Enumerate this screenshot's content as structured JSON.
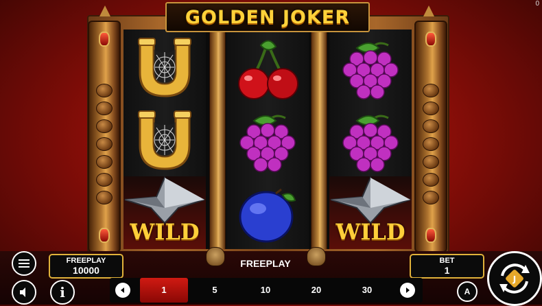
{
  "game": {
    "title": "GOLDEN JOKER",
    "corner_counter": "0"
  },
  "reels": [
    {
      "symbols": [
        "horseshoe",
        "horseshoe",
        "wild"
      ]
    },
    {
      "symbols": [
        "cherry",
        "grapes",
        "plum"
      ]
    },
    {
      "symbols": [
        "grapes",
        "grapes",
        "wild"
      ]
    }
  ],
  "symbols": {
    "wild_label": "WILD"
  },
  "freeplay_box": {
    "label": "FREEPLAY",
    "value": "10000"
  },
  "status_text": "FREEPLAY",
  "bet_box": {
    "label": "BET",
    "value": "1"
  },
  "bet_options": [
    "1",
    "5",
    "10",
    "20",
    "30"
  ],
  "selected_bet": "1",
  "controls": {
    "auto_label": "A",
    "info_label": "i"
  },
  "icons": {
    "menu": "menu-icon",
    "sound": "speaker-icon",
    "info": "info-icon",
    "prev": "chevron-left-icon",
    "next": "chevron-right-icon",
    "spin": "spin-icon"
  },
  "colors": {
    "gold": "#e1b23a",
    "bet_selected": "#d01a12",
    "background": "#8a0e08"
  }
}
